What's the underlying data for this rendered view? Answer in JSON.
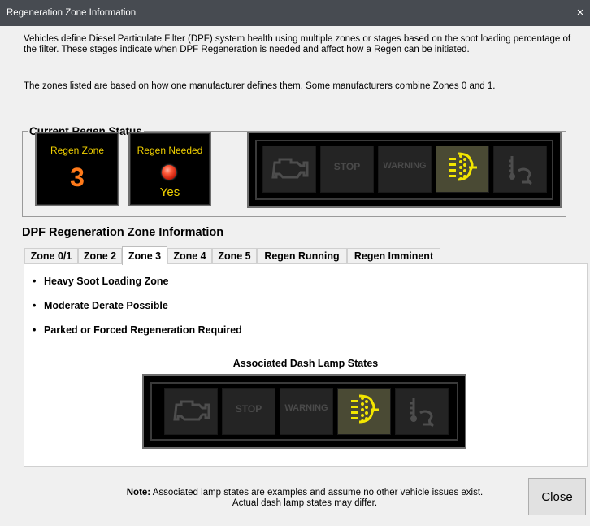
{
  "window": {
    "title": "Regeneration Zone Information",
    "close_glyph": "×"
  },
  "intro": {
    "paragraph1": "Vehicles define Diesel Particulate Filter (DPF) system health using multiple zones or stages based on the soot loading percentage of the filter. These stages indicate when DPF Regeneration is needed and affect how a Regen can be initiated.",
    "paragraph2": "The zones listed are based on how one manufacturer defines them.  Some manufacturers combine Zones 0 and 1."
  },
  "current_status": {
    "legend": "Current Regen Status",
    "regen_zone": {
      "label": "Regen Zone",
      "value": "3",
      "value_color": "#ff7a1a"
    },
    "regen_needed": {
      "label": "Regen Needed",
      "value": "Yes",
      "indicator_color": "#e33a1e"
    },
    "lamps": [
      {
        "name": "check-engine",
        "icon": "engine-icon",
        "active": false
      },
      {
        "name": "stop",
        "text": "STOP",
        "active": false
      },
      {
        "name": "warning",
        "text": "WARNING",
        "active": false
      },
      {
        "name": "dpf",
        "icon": "dpf-filter-icon",
        "active": true,
        "active_color": "#f3e600"
      },
      {
        "name": "exhaust-temp",
        "icon": "high-exhaust-temp-icon",
        "active": false
      }
    ]
  },
  "zone_info": {
    "title": "DPF Regeneration Zone Information",
    "tabs": [
      "Zone 0/1",
      "Zone 2",
      "Zone 3",
      "Zone 4",
      "Zone 5",
      "Regen Running",
      "Regen Imminent"
    ],
    "active_tab": "Zone 3",
    "bullet_glyph": "•",
    "bullets": [
      "Heavy Soot Loading Zone",
      "Moderate Derate Possible",
      "Parked or Forced Regeneration Required"
    ],
    "lamp_states_title": "Associated Dash Lamp States"
  },
  "footer": {
    "note_label": "Note:",
    "note_line1": " Associated lamp states are examples  and assume no other vehicle issues exist.",
    "note_line2": "Actual dash lamp states may differ.",
    "close_label": "Close"
  }
}
